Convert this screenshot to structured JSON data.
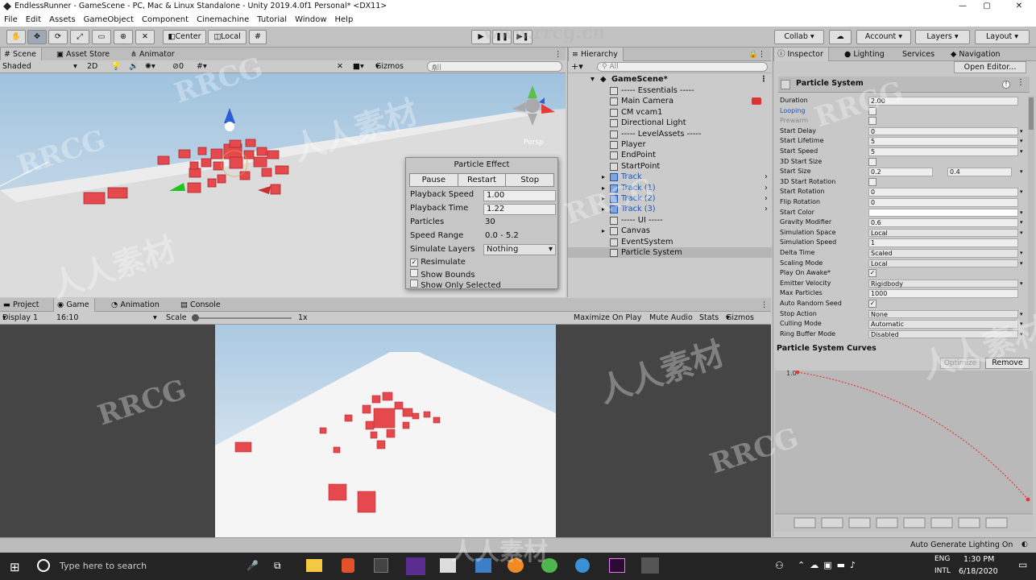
{
  "window": {
    "title": "EndlessRunner - GameScene - PC, Mac & Linux Standalone - Unity 2019.4.0f1 Personal* <DX11>"
  },
  "menu": [
    "File",
    "Edit",
    "Assets",
    "GameObject",
    "Component",
    "Cinemachine",
    "Tutorial",
    "Window",
    "Help"
  ],
  "toolbar": {
    "pivot": "Center",
    "space": "Local",
    "collab": "Collab",
    "account": "Account",
    "layers": "Layers",
    "layout": "Layout"
  },
  "scene_tabs": [
    "Scene",
    "Asset Store",
    "Animator"
  ],
  "scene_bar": {
    "shading": "Shaded",
    "mode2d": "2D",
    "fx_count": "0",
    "gizmos": "Gizmos",
    "search_placeholder": "All",
    "persp": "Persp"
  },
  "bottom_tabs": [
    "Project",
    "Game",
    "Animation",
    "Console"
  ],
  "game_bar": {
    "display": "Display 1",
    "aspect": "16:10",
    "scale_label": "Scale",
    "scale_value": "1x",
    "maximize": "Maximize On Play",
    "mute": "Mute Audio",
    "stats": "Stats",
    "gizmos": "Gizmos"
  },
  "particle_effect": {
    "title": "Particle Effect",
    "pause": "Pause",
    "restart": "Restart",
    "stop": "Stop",
    "playback_speed_label": "Playback Speed",
    "playback_speed": "1.00",
    "playback_time_label": "Playback Time",
    "playback_time": "1.22",
    "particles_label": "Particles",
    "particles": "30",
    "speed_range_label": "Speed Range",
    "speed_range": "0.0 - 5.2",
    "simulate_layers_label": "Simulate Layers",
    "simulate_layers": "Nothing",
    "resimulate": "Resimulate",
    "show_bounds": "Show Bounds",
    "show_only_selected": "Show Only Selected"
  },
  "hierarchy": {
    "tab": "Hierarchy",
    "search_placeholder": "All",
    "scene": "GameScene*",
    "items": [
      "----- Essentials -----",
      "Main Camera",
      "CM vcam1",
      "Directional Light",
      "----- LevelAssets -----",
      "Player",
      "EndPoint",
      "StartPoint",
      "Track",
      "Track (1)",
      "Track (2)",
      "Track (3)",
      "----- UI -----",
      "Canvas",
      "EventSystem",
      "Particle System"
    ]
  },
  "inspector_tabs": [
    "Inspector",
    "Lighting",
    "Services",
    "Navigation"
  ],
  "inspector": {
    "open_editor": "Open Editor...",
    "component": "Particle System",
    "props": [
      {
        "label": "Duration",
        "value": "2.00",
        "type": "field"
      },
      {
        "label": "Looping",
        "value": "",
        "type": "check"
      },
      {
        "label": "Prewarm",
        "value": "",
        "type": "check"
      },
      {
        "label": "Start Delay",
        "value": "0",
        "type": "field"
      },
      {
        "label": "Start Lifetime",
        "value": "5",
        "type": "field"
      },
      {
        "label": "Start Speed",
        "value": "5",
        "type": "field"
      },
      {
        "label": "3D Start Size",
        "value": "",
        "type": "check"
      },
      {
        "label": "Start Size",
        "value": "0.2",
        "value2": "0.4",
        "type": "range"
      },
      {
        "label": "3D Start Rotation",
        "value": "",
        "type": "check"
      },
      {
        "label": "Start Rotation",
        "value": "0",
        "type": "field"
      },
      {
        "label": "Flip Rotation",
        "value": "0",
        "type": "field"
      },
      {
        "label": "Start Color",
        "value": "",
        "type": "color"
      },
      {
        "label": "Gravity Modifier",
        "value": "0.6",
        "type": "field"
      },
      {
        "label": "Simulation Space",
        "value": "Local",
        "type": "dropdown"
      },
      {
        "label": "Simulation Speed",
        "value": "1",
        "type": "field"
      },
      {
        "label": "Delta Time",
        "value": "Scaled",
        "type": "dropdown"
      },
      {
        "label": "Scaling Mode",
        "value": "Local",
        "type": "dropdown"
      },
      {
        "label": "Play On Awake*",
        "value": "✓",
        "type": "check"
      },
      {
        "label": "Emitter Velocity",
        "value": "Rigidbody",
        "type": "dropdown"
      },
      {
        "label": "Max Particles",
        "value": "1000",
        "type": "field"
      },
      {
        "label": "Auto Random Seed",
        "value": "✓",
        "type": "check"
      },
      {
        "label": "Stop Action",
        "value": "None",
        "type": "dropdown"
      },
      {
        "label": "Culling Mode",
        "value": "Automatic",
        "type": "dropdown"
      },
      {
        "label": "Ring Buffer Mode",
        "value": "Disabled",
        "type": "dropdown"
      }
    ]
  },
  "curves": {
    "title": "Particle System Curves",
    "optimize": "Optimize",
    "remove": "Remove",
    "y_label": "1.0"
  },
  "status": {
    "text": "Auto Generate Lighting On"
  },
  "taskbar": {
    "search_placeholder": "Type here to search",
    "lang1": "ENG",
    "lang2": "INTL",
    "time": "1:30 PM",
    "date": "6/18/2020"
  },
  "watermark": {
    "a": "RRCG",
    "b": "人人素材",
    "url": "www.rrcg.cn"
  },
  "colors": {
    "accent_red": "#e5484d",
    "selection_blue": "#1a55b8"
  }
}
